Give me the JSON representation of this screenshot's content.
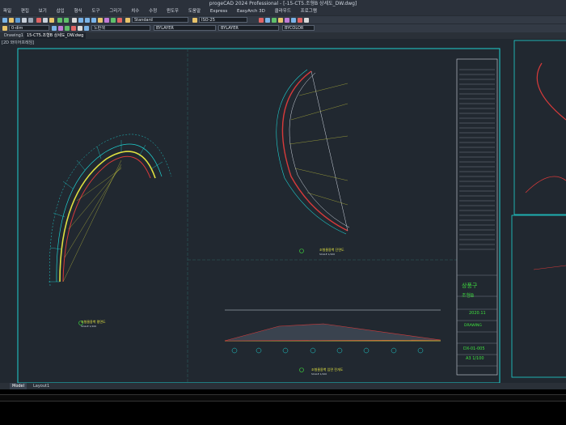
{
  "app": {
    "title": "progeCAD 2024 Professional - [-15-CT5.조형B 상세도_DW.dwg]"
  },
  "menu": {
    "items": [
      "파일",
      "편집",
      "보기",
      "삽입",
      "형식",
      "도구",
      "그리기",
      "치수",
      "수정",
      "윈도우",
      "도움말",
      "Express",
      "EasyArch 3D",
      "클라우드",
      "프로그램"
    ]
  },
  "toolbar": {
    "text_style": "Standard",
    "dim_style": "ISO-25",
    "layer": "0-dim",
    "color": "노란색",
    "linetype": "BYLAYER",
    "lineweight": "BYLAYER",
    "plotstyle": "BYCOLOR"
  },
  "doc_tabs": [
    {
      "label": "Drawing1",
      "active": false
    },
    {
      "label": "15-CT5.조형B 상세도_DW.dwg",
      "active": true
    }
  ],
  "viewport_label": "[2D 와이어프레임]",
  "drawing": {
    "title_block": {
      "project": "상풍구",
      "subtitle": "조형B",
      "date": "2020.11",
      "drawing_no": "DX-01-005",
      "scale": "A3 1/100",
      "drafter": "DRAWING"
    },
    "labels": {
      "plan_arc": "조형물용벽 평면도",
      "plan_arc_scale": "SCALE 1/100",
      "section": "조형물용벽 단면도",
      "section_scale": "SCALE 1/100",
      "elevation": "조형물용벽 입면 전개도",
      "elevation_scale": "SCALE 1/100"
    }
  },
  "layout_tabs": [
    {
      "label": "Model",
      "active": true
    },
    {
      "label": "Layout1",
      "active": false
    }
  ]
}
